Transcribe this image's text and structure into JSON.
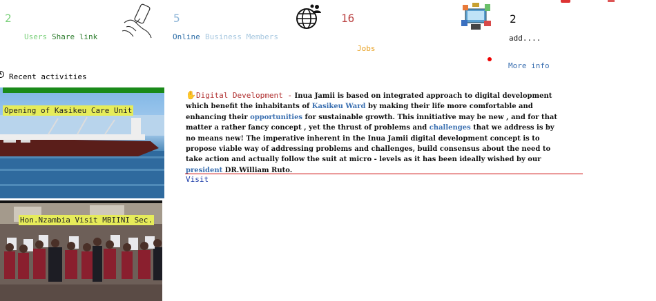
{
  "stats": {
    "users": {
      "count": "2",
      "label": "Users",
      "share_label": "Share link"
    },
    "online": {
      "count": "5",
      "label_a": "Online",
      "label_b": "Business Members"
    },
    "jobs": {
      "count": "16",
      "label": "Jobs"
    },
    "add": {
      "count": "2",
      "label": "add....",
      "more_info": "More info"
    }
  },
  "recent": {
    "title": "Recent activities",
    "items": [
      {
        "caption": "Opening of Kasikeu Care Unit"
      },
      {
        "caption": "Hon.Nzambia Visit MBIINI Sec."
      }
    ]
  },
  "article": {
    "heading": "Digital Development -",
    "p1": " Inua Jamii is based on integrated approach to digital development which benefit the inhabitants of ",
    "hl1": "Kasikeu Ward",
    "p2": " by making their life more comfortable and enhancing their ",
    "hl2": "opportunities",
    "p3": " for sustainable growth. This innitiative may be new , and for that matter a rather fancy concept , yet the thrust of problems and ",
    "hl3": "challenges",
    "p4": " that we address is by no means new! The imperative inherent in the Inua Jamii digital development concept is to propose viable way of addressing problems and challenges, build consensus about the need to take action and actually follow the suit at micro - levels as it has been ideally wished by our ",
    "hl4": "president",
    "p5": " DR.William Ruto.",
    "visit_label": "Visit"
  },
  "colors": {
    "users_count": "#7bd07b",
    "users_label": "#7bd07b",
    "share_link": "#2e7d2e",
    "online_count": "#8fb6d8",
    "online_label": "#2f6fa8",
    "business": "#a8c8e0",
    "jobs_count": "#b44",
    "jobs_label": "#e8a020",
    "more_info": "#3a6fb0",
    "visit": "#1a3aa8",
    "divider": "#c00",
    "green_bar": "#1a8a1a"
  }
}
